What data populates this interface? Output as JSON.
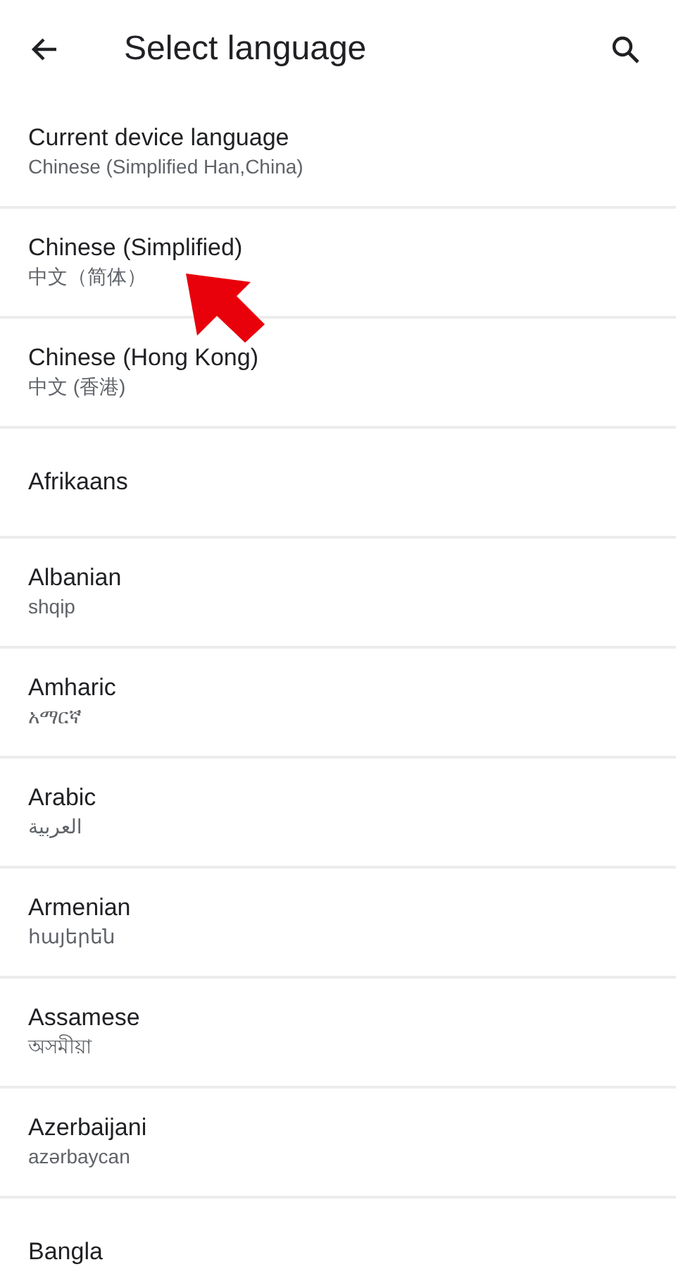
{
  "app_bar": {
    "title": "Select language"
  },
  "languages": [
    {
      "name": "Current device language",
      "native": "Chinese (Simplified Han,China)"
    },
    {
      "name": "Chinese (Simplified)",
      "native": "中文（简体）"
    },
    {
      "name": "Chinese (Hong Kong)",
      "native": "中文 (香港)"
    },
    {
      "name": "Afrikaans"
    },
    {
      "name": "Albanian",
      "native": "shqip"
    },
    {
      "name": "Amharic",
      "native": "አማርኛ"
    },
    {
      "name": "Arabic",
      "native": "العربية"
    },
    {
      "name": "Armenian",
      "native": "հայերեն"
    },
    {
      "name": "Assamese",
      "native": "অসমীয়া"
    },
    {
      "name": "Azerbaijani",
      "native": "azərbaycan"
    },
    {
      "name": "Bangla"
    }
  ]
}
